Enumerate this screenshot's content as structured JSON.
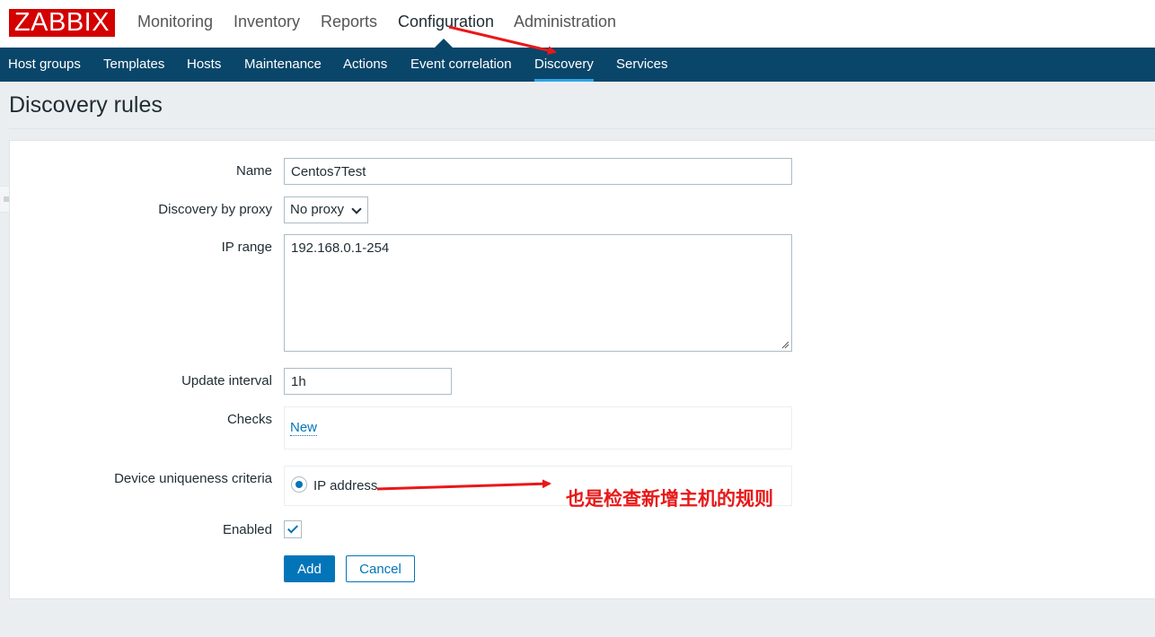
{
  "app": {
    "logo": "ZABBIX"
  },
  "main_menu": {
    "items": [
      "Monitoring",
      "Inventory",
      "Reports",
      "Configuration",
      "Administration"
    ],
    "active": "Configuration"
  },
  "sub_menu": {
    "items": [
      "Host groups",
      "Templates",
      "Hosts",
      "Maintenance",
      "Actions",
      "Event correlation",
      "Discovery",
      "Services"
    ],
    "active": "Discovery"
  },
  "page": {
    "title": "Discovery rules"
  },
  "form": {
    "name_label": "Name",
    "name_value": "Centos7Test",
    "proxy_label": "Discovery by proxy",
    "proxy_value": "No proxy",
    "ip_range_label": "IP range",
    "ip_range_value": "192.168.0.1-254",
    "interval_label": "Update interval",
    "interval_value": "1h",
    "checks_label": "Checks",
    "checks_new_link": "New",
    "uniqueness_label": "Device uniqueness criteria",
    "uniqueness_option": "IP address",
    "uniqueness_selected": true,
    "enabled_label": "Enabled",
    "enabled": true,
    "add_button": "Add",
    "cancel_button": "Cancel"
  },
  "annotations": {
    "note": "也是检查新增主机的规则",
    "arrow_color": "#e81818"
  },
  "colors": {
    "brand_red": "#d40000",
    "nav_bg": "#0a466a",
    "accent_blue": "#0275b8",
    "page_bg": "#ebeef0"
  }
}
